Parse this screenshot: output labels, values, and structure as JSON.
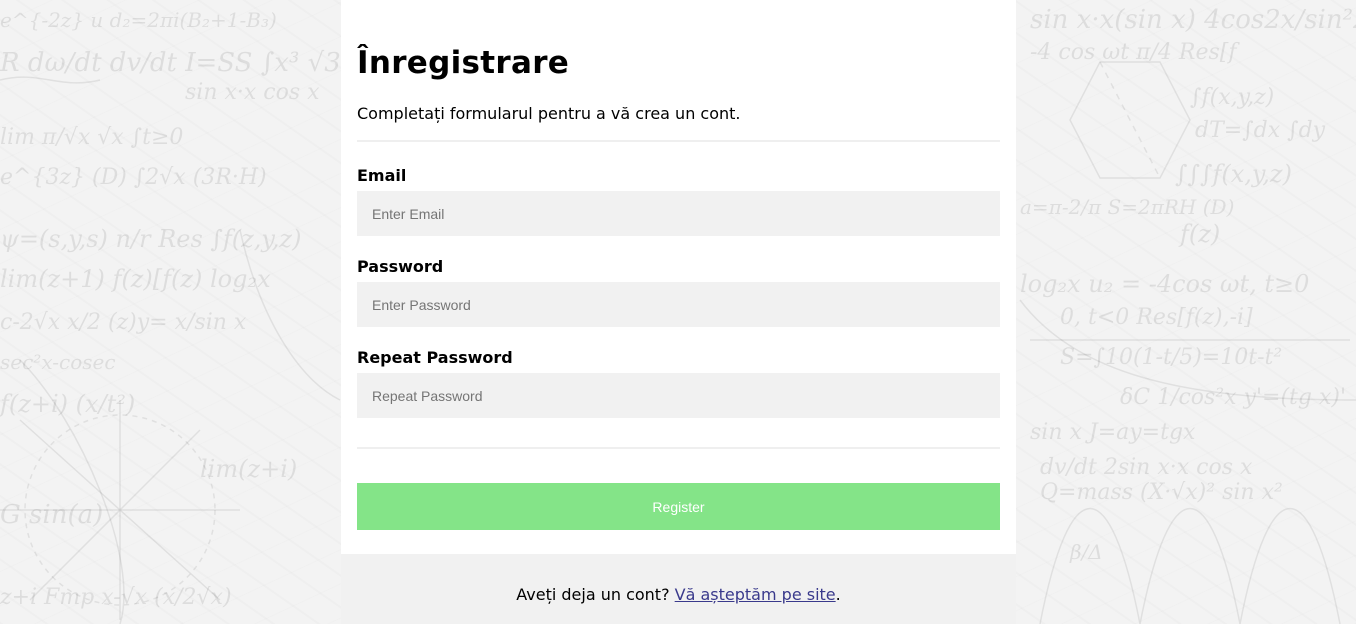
{
  "form": {
    "title": "Înregistrare",
    "subtitle": "Completați formularul pentru a vă crea un cont.",
    "email_label": "Email",
    "email_placeholder": "Enter Email",
    "password_label": "Password",
    "password_placeholder": "Enter Password",
    "repeat_label": "Repeat Password",
    "repeat_placeholder": "Repeat Password",
    "register_label": "Register"
  },
  "footer": {
    "prefix": "Aveți deja un cont? ",
    "link_text": "Vă așteptăm pe site",
    "suffix": "."
  },
  "colors": {
    "register_button": "#84e488",
    "input_background": "#f1f1f1",
    "footer_background": "#f1f1f1",
    "link": "#3a3a8c"
  }
}
